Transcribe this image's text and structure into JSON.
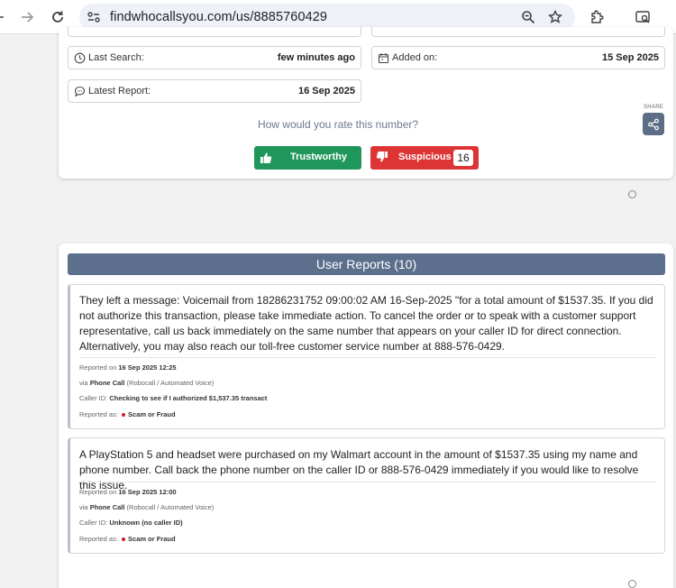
{
  "browser": {
    "url": "findwhocallsyou.com/us/8885760429",
    "icons": [
      "back-arrow-icon",
      "forward-arrow-icon",
      "reload-icon",
      "site-info-icon",
      "zoom-icon",
      "bookmark-star-icon",
      "extensions-icon",
      "lens-search-icon"
    ]
  },
  "info": {
    "last_search_label": "Last Search:",
    "last_search_value": "few minutes ago",
    "added_on_label": "Added on:",
    "added_on_value": "15 Sep 2025",
    "latest_report_label": "Latest Report:",
    "latest_report_value": "16 Sep 2025"
  },
  "rating": {
    "question": "How would you rate this number?",
    "trustworthy_label": "Trustworthy",
    "suspicious_label": "Suspicious",
    "suspicious_count": "16"
  },
  "share": {
    "label": "SHARE"
  },
  "reports": {
    "header": "User Reports (10)",
    "items": [
      {
        "text": "They left a message: Voicemail from 18286231752 09:00:02 AM 16-Sep-2025 \"for a total amount of $1537.35. If you did not authorize this transaction, please take immediate action. To cancel the order or to speak with a customer support representative, call us back immediately on the same number that appears on your caller ID for direct connection. Alternatively, you may also reach our toll-free customer service number at 888-576-0429.",
        "reported_on_label": "Reported on",
        "reported_on": "16 Sep 2025 12:25",
        "via_label": "via",
        "via": "Phone Call",
        "via_detail": "(Robocall / Automated Voice)",
        "caller_id_label": "Caller ID:",
        "caller_id": "Checking to see if I authorized $1,537.35 transact",
        "reported_as_label": "Reported as:",
        "reported_as": "Scam or Fraud"
      },
      {
        "text": "A PlayStation 5 and headset were purchased on my Walmart account in the amount of $1537.35 using my name and phone number. Call back the phone number on the caller ID or 888-576-0429 immediately if you would like to resolve this issue.",
        "reported_on_label": "Reported on",
        "reported_on": "16 Sep 2025 12:00",
        "via_label": "via",
        "via": "Phone Call",
        "via_detail": "(Robocall / Automated Voice)",
        "caller_id_label": "Caller ID:",
        "caller_id": "Unknown (no caller ID)",
        "reported_as_label": "Reported as:",
        "reported_as": "Scam or Fraud"
      }
    ]
  },
  "colors": {
    "trustworthy": "#20975a",
    "suspicious": "#dd3535",
    "header_bar": "#5c6f8c",
    "scam_dot": "#d01f1f"
  }
}
